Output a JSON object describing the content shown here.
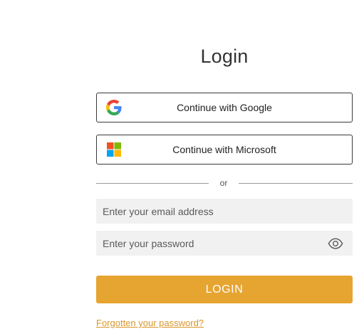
{
  "login": {
    "title": "Login",
    "google_button_label": "Continue with Google",
    "microsoft_button_label": "Continue with Microsoft",
    "divider_text": "or",
    "email_placeholder": "Enter your email address",
    "email_value": "",
    "password_placeholder": "Enter your password",
    "password_value": "",
    "submit_label": "LOGIN",
    "forgot_password_link": "Forgotten your password?"
  },
  "icons": {
    "google": "google-logo-icon",
    "microsoft": "microsoft-logo-icon",
    "show_password": "eye-icon"
  },
  "colors": {
    "accent": "#e6a431",
    "link": "#d9962a",
    "field_background": "#f1f1f1",
    "button_border": "#3a3a3a"
  }
}
